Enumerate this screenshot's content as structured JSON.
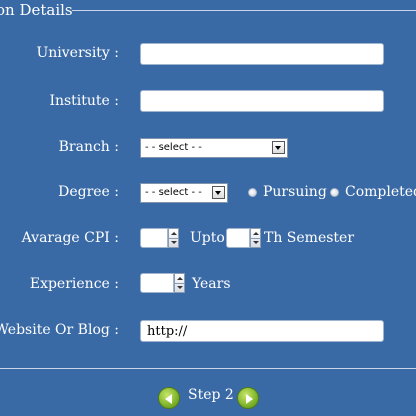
{
  "fieldset": {
    "legend": "on Details"
  },
  "form": {
    "university": {
      "label": "University :",
      "value": ""
    },
    "institute": {
      "label": "Institute :",
      "value": ""
    },
    "branch": {
      "label": "Branch :",
      "selected": "- - select - -"
    },
    "degree": {
      "label": "Degree :",
      "selected": "- - select - -",
      "radio_pursuing": "Pursuing",
      "radio_completed": "Completed"
    },
    "cpi": {
      "label": "Avarage CPI :",
      "value": "",
      "upto": "Upto",
      "semester_value": "",
      "semester_suffix": "Th Semester"
    },
    "experience": {
      "label": "Experience :",
      "value": "",
      "suffix": "Years"
    },
    "website": {
      "label": "r Website Or Blog :",
      "value": "http://"
    }
  },
  "footer": {
    "step_label": "Step 2"
  },
  "icons": {
    "prev": "arrow-left-icon",
    "next": "arrow-right-icon",
    "dropdown": "chevron-down-icon"
  },
  "colors": {
    "background": "#3a6aa6",
    "button": "#7fb32a"
  }
}
